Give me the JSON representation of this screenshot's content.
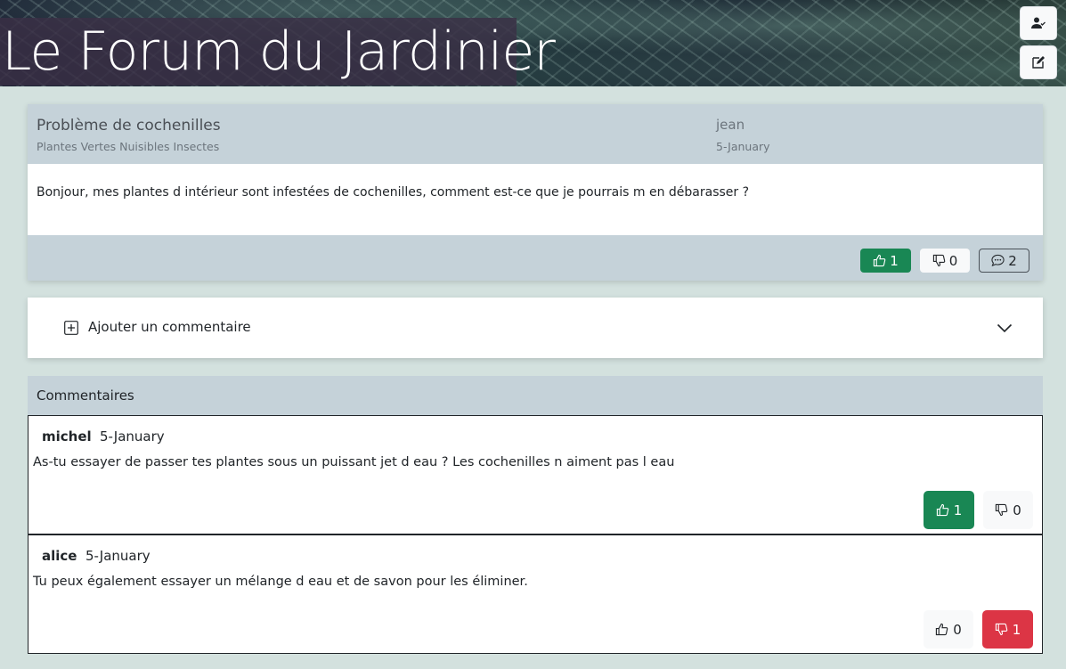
{
  "site": {
    "title": "Le Forum du Jardinier"
  },
  "header": {
    "user_button_icon": "user-check-icon",
    "edit_button_icon": "pencil-square-icon"
  },
  "post": {
    "title": "Problème de cochenilles",
    "tags": "Plantes Vertes Nuisibles Insectes",
    "author": "jean",
    "date": "5-January",
    "body": "Bonjour, mes plantes d intérieur sont infestées de cochenilles, comment est-ce que je pourrais m en débarasser ?",
    "likes": "1",
    "dislikes": "0",
    "comments": "2"
  },
  "add_comment": {
    "label": "Ajouter un commentaire"
  },
  "comments_section": {
    "title": "Commentaires",
    "items": [
      {
        "author": "michel",
        "date": "5-January",
        "text": "As-tu essayer de passer tes plantes sous un puissant jet d eau ? Les cochenilles n aiment pas l eau",
        "likes": "1",
        "dislikes": "0"
      },
      {
        "author": "alice",
        "date": "5-January",
        "text": "Tu peux également essayer un mélange d eau et de savon pour les éliminer.",
        "likes": "0",
        "dislikes": "1"
      }
    ]
  },
  "colors": {
    "like_active": "#198754",
    "dislike_active": "#dc3545",
    "card_header": "#c5d2d9",
    "page_bg": "#d3e1de"
  }
}
